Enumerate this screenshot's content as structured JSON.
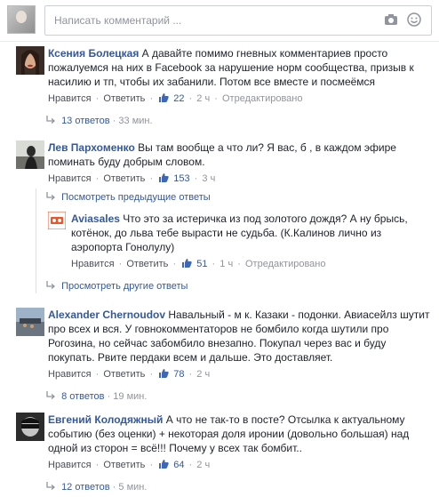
{
  "composer": {
    "placeholder": "Написать комментарий ...",
    "icons": [
      "camera-icon",
      "smiley-icon"
    ]
  },
  "actions": {
    "like": "Нравится",
    "reply": "Ответить",
    "edited": "Отредактировано"
  },
  "comments": [
    {
      "author": "Ксения Болецкая",
      "text": "А давайте помимо гневных комментариев просто пожалуемся на них в Facebook за нарушение норм сообщества, призыв к насилию и тп, чтобы их забанили. Потом все вместе и посмеёмся",
      "likes": "22",
      "time": "2 ч",
      "replies": "13 ответов",
      "replies_time": "33 мин."
    },
    {
      "author": "Лев Пархоменко",
      "text": "Вы там вообще а        что ли? Я вас, б      , в каждом эфире поминать буду добрым словом.",
      "likes": "153",
      "time": "3 ч",
      "prev_replies": "Посмотреть предыдущие ответы",
      "more_replies": "Просмотреть другие ответы",
      "reply": {
        "author": "Aviasales",
        "text": "Что это за истеричка из под золотого дождя? А ну брысь, котёнок, до льва тебе вырасти не судьба. (К.Калинов лично из аэропорта Гонолулу)",
        "likes": "51",
        "time": "1 ч"
      }
    },
    {
      "author": "Alexander Chernoudov",
      "text": "Навальный - м     к. Казаки - подонки. Авиасейлз шутит про всех и вся. У говнокомментаторов не бомбило когда шутили про Рогозина, но сейчас забомбило внезапно. Покупал через вас и буду покупать. Рвите пердаки всем и дальше. Это доставляет.",
      "likes": "78",
      "time": "2 ч",
      "replies": "8 ответов",
      "replies_time": "19 мин."
    },
    {
      "author": "Евгений Колодяжный",
      "text": "А что не так-то в посте? Отсылка к актуальному событию (без оценки) + некоторая доля иронии (довольно большая) над одной из сторон = всё!!! Почему у всех так бомбит..",
      "likes": "64",
      "time": "2 ч",
      "replies": "12 ответов",
      "replies_time": "5 мин."
    }
  ],
  "colors": {
    "link": "#365899",
    "meta": "#90949c",
    "brand_avia": "#e8562a"
  }
}
